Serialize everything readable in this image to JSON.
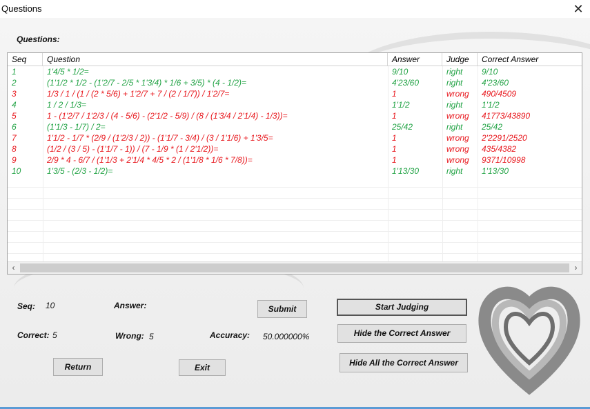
{
  "window": {
    "title": "Questions"
  },
  "questions_label": "Questions:",
  "table": {
    "columns": [
      "Seq",
      "Question",
      "Answer",
      "Judge",
      "Correct Answer"
    ],
    "rows": [
      {
        "seq": "1",
        "question": "1'4/5 * 1/2=",
        "answer": "9/10",
        "judge": "right",
        "correct": "9/10",
        "status": "right"
      },
      {
        "seq": "2",
        "question": "(1'1/2 * 1/2 - (1'2/7 - 2/5 * 1'3/4) * 1/6 + 3/5) * (4 - 1/2)=",
        "answer": "4'23/60",
        "judge": "right",
        "correct": "4'23/60",
        "status": "right"
      },
      {
        "seq": "3",
        "question": "1/3 / 1 / (1 / (2 * 5/6) + 1'2/7 + 7 / (2 / 1/7)) / 1'2/7=",
        "answer": "1",
        "judge": "wrong",
        "correct": "490/4509",
        "status": "wrong"
      },
      {
        "seq": "4",
        "question": "1 / 2 / 1/3=",
        "answer": "1'1/2",
        "judge": "right",
        "correct": "1'1/2",
        "status": "right"
      },
      {
        "seq": "5",
        "question": "1 - (1'2/7 / 1'2/3 / (4 - 5/6) - (2'1/2 - 5/9) / (8 / (1'3/4 / 2'1/4) - 1/3))=",
        "answer": "1",
        "judge": "wrong",
        "correct": "41773/43890",
        "status": "wrong"
      },
      {
        "seq": "6",
        "question": "(1'1/3 - 1/7) / 2=",
        "answer": "25/42",
        "judge": "right",
        "correct": "25/42",
        "status": "right"
      },
      {
        "seq": "7",
        "question": "1'1/2 - 1/7 * (2/9 / (1'2/3 / 2)) - (1'1/7 - 3/4) / (3 / 1'1/6) + 1'3/5=",
        "answer": "1",
        "judge": "wrong",
        "correct": "2'2291/2520",
        "status": "wrong"
      },
      {
        "seq": "8",
        "question": "(1/2 / (3 / 5) - (1'1/7 - 1)) / (7 - 1/9 * (1 / 2'1/2))=",
        "answer": "1",
        "judge": "wrong",
        "correct": "435/4382",
        "status": "wrong"
      },
      {
        "seq": "9",
        "question": "2/9 * 4 - 6/7 / (1'1/3 + 2'1/4 * 4/5 * 2 / (1'1/8 * 1/6 * 7/8))=",
        "answer": "1",
        "judge": "wrong",
        "correct": "9371/10998",
        "status": "wrong"
      },
      {
        "seq": "10",
        "question": "1'3/5 - (2/3 - 1/2)=",
        "answer": "1'13/30",
        "judge": "right",
        "correct": "1'13/30",
        "status": "right"
      }
    ]
  },
  "colors": {
    "right": "#22a345",
    "wrong": "#e8171d"
  },
  "form": {
    "seq_label": "Seq:",
    "seq_value": "10",
    "answer_label": "Answer:",
    "answer_value": "",
    "correct_label": "Correct:",
    "correct_value": "5",
    "wrong_label": "Wrong:",
    "wrong_value": "5",
    "accuracy_label": "Accuracy:",
    "accuracy_value": "50.000000%"
  },
  "buttons": {
    "submit": "Submit",
    "start_judging": "Start Judging",
    "hide_correct": "Hide the Correct Answer",
    "hide_all": "Hide All the Correct Answer",
    "return": "Return",
    "exit": "Exit"
  }
}
